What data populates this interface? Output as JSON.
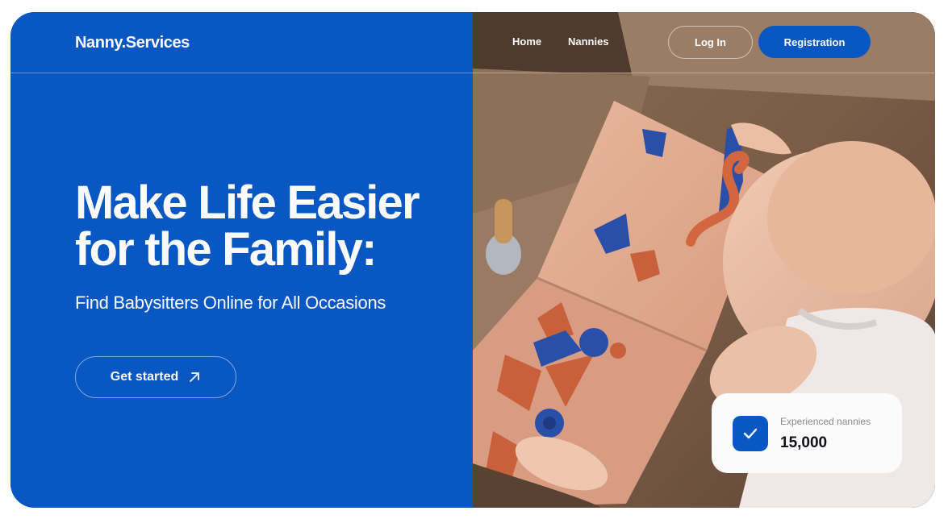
{
  "brand": {
    "logo": "Nanny.Services"
  },
  "nav": {
    "home": "Home",
    "nannies": "Nannies"
  },
  "auth": {
    "login": "Log In",
    "register": "Registration"
  },
  "hero": {
    "headline_line1": "Make Life Easier",
    "headline_line2": "for the Family:",
    "subheadline": "Find Babysitters Online for All Occasions",
    "cta": "Get started",
    "cta_icon": "arrow-up-right-icon"
  },
  "stats": {
    "label": "Experienced nannies",
    "value": "15,000",
    "icon": "check-icon"
  },
  "colors": {
    "brand_blue": "#0957c3",
    "text_light": "#fbfbfb",
    "text_dark": "#11101c",
    "text_muted": "#8a8a89"
  }
}
